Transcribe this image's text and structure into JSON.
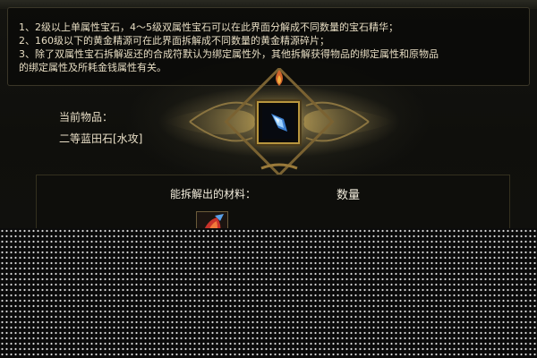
{
  "instructions": [
    "1、2级以上单属性宝石，4～5级双属性宝石可以在此界面分解成不同数量的宝石精华；",
    "2、160级以下的黄金精源可在此界面拆解成不同数量的黄金精源碎片；",
    "3、除了双属性宝石拆解返还的合成符默认为绑定属性外，其他拆解获得物品的绑定属性和原物品",
    "的绑定属性及所耗金钱属性有关。"
  ],
  "current_item": {
    "label": "当前物品：",
    "name": "二等蓝田石[水攻]"
  },
  "materials": {
    "header": "能拆解出的材料：",
    "quantity_header": "数量"
  },
  "icons": {
    "current_item": "blue-gem-icon",
    "material": "red-essence-icon"
  },
  "colors": {
    "text": "#e6dcc2",
    "frame_gold": "#b8963e"
  }
}
